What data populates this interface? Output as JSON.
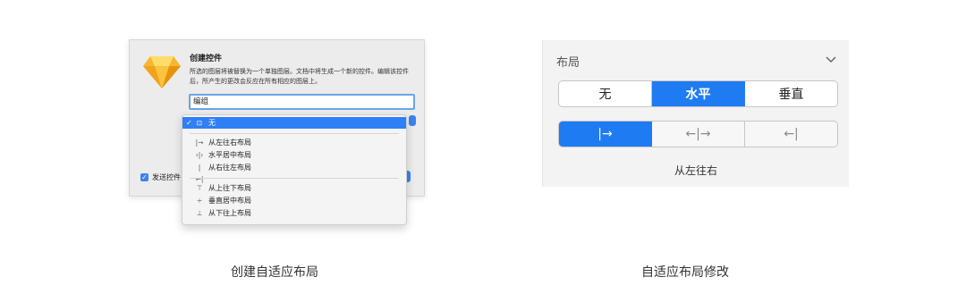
{
  "left": {
    "dialog": {
      "title": "创建控件",
      "description": "所选的图层将被替换为一个单独图层。文档中将生成一个新的控件。编辑该控件后，所产生的更改会反应在所有相应的图层上。",
      "name_value": "编组",
      "send_checkbox_label": "发送控件",
      "send_checked": true
    },
    "menu": {
      "selected": {
        "icon": "⊡",
        "label": "无"
      },
      "horizontal": [
        {
          "icon": "|→",
          "label": "从左往右布局"
        },
        {
          "icon": "‹|›",
          "label": "水平居中布局"
        },
        {
          "icon": "|←|",
          "label": "从右往左布局"
        }
      ],
      "vertical": [
        {
          "icon": "⊤",
          "label": "从上往下布局"
        },
        {
          "icon": "÷",
          "label": "垂直居中布局"
        },
        {
          "icon": "⊥",
          "label": "从下往上布局"
        }
      ]
    },
    "caption": "创建自适应布局"
  },
  "right": {
    "panel_title": "布局",
    "direction_segments": [
      "无",
      "水平",
      "垂直"
    ],
    "direction_active": "水平",
    "align_icons": [
      "|→",
      "←|→",
      "←|"
    ],
    "align_active_index": 0,
    "value_label": "从左往右",
    "caption": "自适应布局修改"
  },
  "colors": {
    "accent": "#1f7bf2",
    "menu_highlight": "#2f7ff6",
    "input_border": "#6aa4e8"
  }
}
